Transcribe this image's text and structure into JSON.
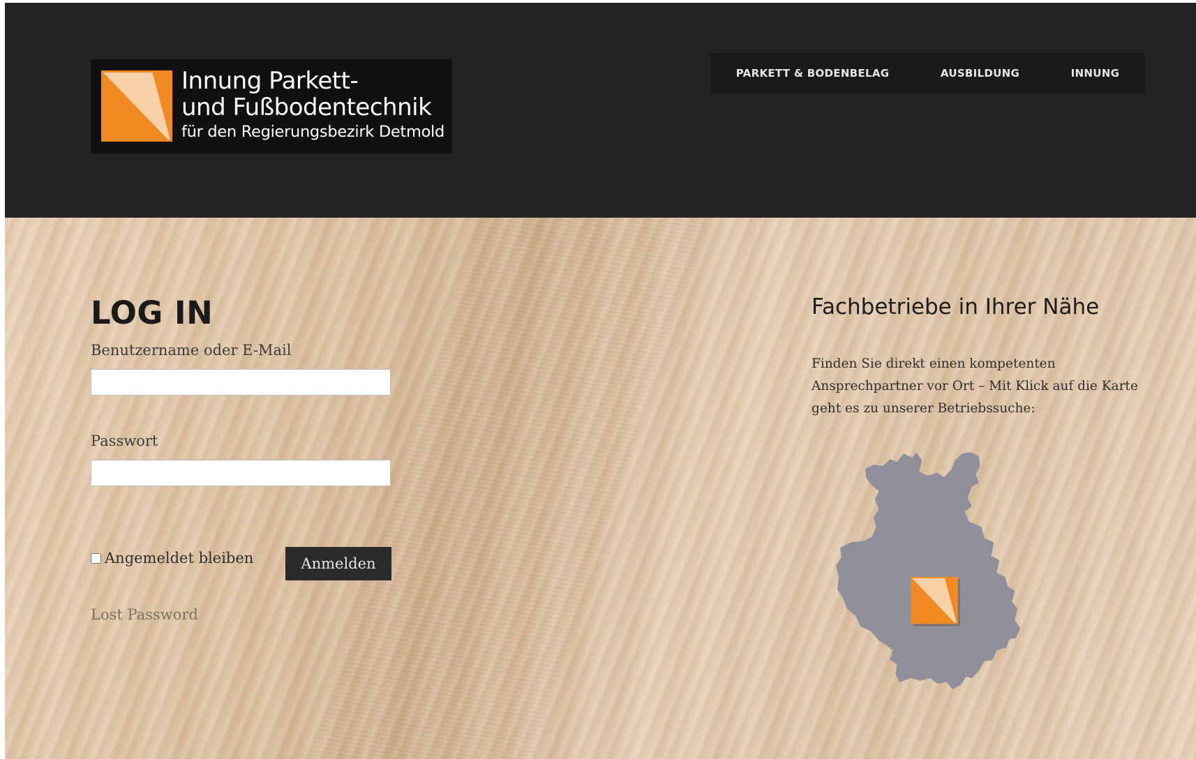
{
  "brand": {
    "line1": "Innung Parkett-",
    "line2": "und Fußbodentechnik",
    "line3": "für den Regierungsbezirk Detmold",
    "accent_color": "#f28a24",
    "logo_icon": "parquet-tile-logo"
  },
  "nav": {
    "items": [
      {
        "label": "PARKETT & BODENBELAG"
      },
      {
        "label": "AUSBILDUNG"
      },
      {
        "label": "INNUNG"
      }
    ]
  },
  "login": {
    "title": "LOG IN",
    "username_label": "Benutzername oder E-Mail",
    "username_value": "",
    "password_label": "Passwort",
    "password_value": "",
    "remember_label": "Angemeldet bleiben",
    "remember_checked": false,
    "submit_label": "Anmelden",
    "lost_password": "Lost Password"
  },
  "sidebar": {
    "title": "Fachbetriebe in Ihrer Nähe",
    "text": "Finden Sie direkt einen kompetenten Ansprechpartner vor Ort – Mit Klick auf die Karte geht es zu unserer Betriebssuche:",
    "map_color": "#8f8f9c",
    "map_icon": "region-map"
  }
}
